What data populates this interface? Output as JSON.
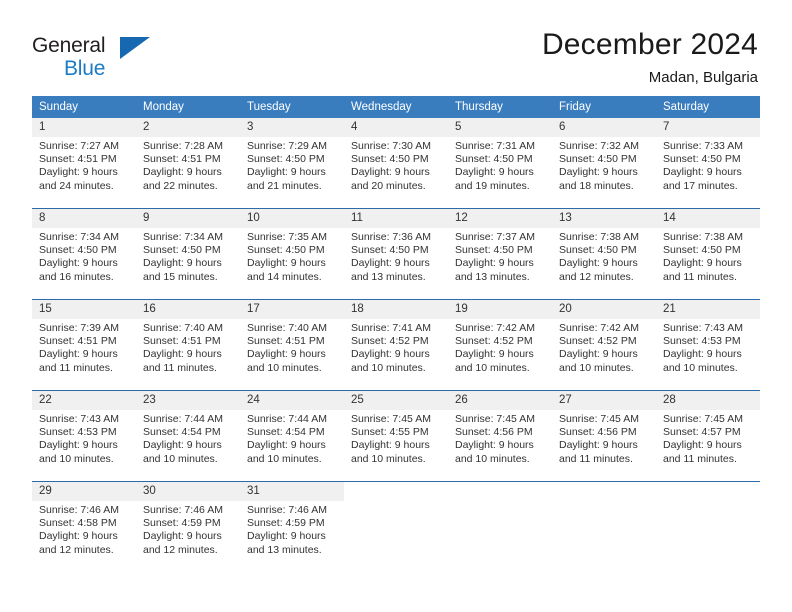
{
  "brand": {
    "name_top": "General",
    "name_bottom": "Blue",
    "accent_color": "#1668b0",
    "text_color": "#231f20"
  },
  "header": {
    "title": "December 2024",
    "subtitle": "Madan, Bulgaria"
  },
  "theme": {
    "header_bg": "#3a7dbf",
    "header_text": "#ffffff",
    "row_divider": "#2b6ca8",
    "daynum_bg": "#f0f0f0",
    "body_text": "#333333"
  },
  "weekday_headers": [
    "Sunday",
    "Monday",
    "Tuesday",
    "Wednesday",
    "Thursday",
    "Friday",
    "Saturday"
  ],
  "weeks": [
    [
      {
        "day": "1",
        "sunrise": "Sunrise: 7:27 AM",
        "sunset": "Sunset: 4:51 PM",
        "daylight_line1": "Daylight: 9 hours",
        "daylight_line2": "and 24 minutes."
      },
      {
        "day": "2",
        "sunrise": "Sunrise: 7:28 AM",
        "sunset": "Sunset: 4:51 PM",
        "daylight_line1": "Daylight: 9 hours",
        "daylight_line2": "and 22 minutes."
      },
      {
        "day": "3",
        "sunrise": "Sunrise: 7:29 AM",
        "sunset": "Sunset: 4:50 PM",
        "daylight_line1": "Daylight: 9 hours",
        "daylight_line2": "and 21 minutes."
      },
      {
        "day": "4",
        "sunrise": "Sunrise: 7:30 AM",
        "sunset": "Sunset: 4:50 PM",
        "daylight_line1": "Daylight: 9 hours",
        "daylight_line2": "and 20 minutes."
      },
      {
        "day": "5",
        "sunrise": "Sunrise: 7:31 AM",
        "sunset": "Sunset: 4:50 PM",
        "daylight_line1": "Daylight: 9 hours",
        "daylight_line2": "and 19 minutes."
      },
      {
        "day": "6",
        "sunrise": "Sunrise: 7:32 AM",
        "sunset": "Sunset: 4:50 PM",
        "daylight_line1": "Daylight: 9 hours",
        "daylight_line2": "and 18 minutes."
      },
      {
        "day": "7",
        "sunrise": "Sunrise: 7:33 AM",
        "sunset": "Sunset: 4:50 PM",
        "daylight_line1": "Daylight: 9 hours",
        "daylight_line2": "and 17 minutes."
      }
    ],
    [
      {
        "day": "8",
        "sunrise": "Sunrise: 7:34 AM",
        "sunset": "Sunset: 4:50 PM",
        "daylight_line1": "Daylight: 9 hours",
        "daylight_line2": "and 16 minutes."
      },
      {
        "day": "9",
        "sunrise": "Sunrise: 7:34 AM",
        "sunset": "Sunset: 4:50 PM",
        "daylight_line1": "Daylight: 9 hours",
        "daylight_line2": "and 15 minutes."
      },
      {
        "day": "10",
        "sunrise": "Sunrise: 7:35 AM",
        "sunset": "Sunset: 4:50 PM",
        "daylight_line1": "Daylight: 9 hours",
        "daylight_line2": "and 14 minutes."
      },
      {
        "day": "11",
        "sunrise": "Sunrise: 7:36 AM",
        "sunset": "Sunset: 4:50 PM",
        "daylight_line1": "Daylight: 9 hours",
        "daylight_line2": "and 13 minutes."
      },
      {
        "day": "12",
        "sunrise": "Sunrise: 7:37 AM",
        "sunset": "Sunset: 4:50 PM",
        "daylight_line1": "Daylight: 9 hours",
        "daylight_line2": "and 13 minutes."
      },
      {
        "day": "13",
        "sunrise": "Sunrise: 7:38 AM",
        "sunset": "Sunset: 4:50 PM",
        "daylight_line1": "Daylight: 9 hours",
        "daylight_line2": "and 12 minutes."
      },
      {
        "day": "14",
        "sunrise": "Sunrise: 7:38 AM",
        "sunset": "Sunset: 4:50 PM",
        "daylight_line1": "Daylight: 9 hours",
        "daylight_line2": "and 11 minutes."
      }
    ],
    [
      {
        "day": "15",
        "sunrise": "Sunrise: 7:39 AM",
        "sunset": "Sunset: 4:51 PM",
        "daylight_line1": "Daylight: 9 hours",
        "daylight_line2": "and 11 minutes."
      },
      {
        "day": "16",
        "sunrise": "Sunrise: 7:40 AM",
        "sunset": "Sunset: 4:51 PM",
        "daylight_line1": "Daylight: 9 hours",
        "daylight_line2": "and 11 minutes."
      },
      {
        "day": "17",
        "sunrise": "Sunrise: 7:40 AM",
        "sunset": "Sunset: 4:51 PM",
        "daylight_line1": "Daylight: 9 hours",
        "daylight_line2": "and 10 minutes."
      },
      {
        "day": "18",
        "sunrise": "Sunrise: 7:41 AM",
        "sunset": "Sunset: 4:52 PM",
        "daylight_line1": "Daylight: 9 hours",
        "daylight_line2": "and 10 minutes."
      },
      {
        "day": "19",
        "sunrise": "Sunrise: 7:42 AM",
        "sunset": "Sunset: 4:52 PM",
        "daylight_line1": "Daylight: 9 hours",
        "daylight_line2": "and 10 minutes."
      },
      {
        "day": "20",
        "sunrise": "Sunrise: 7:42 AM",
        "sunset": "Sunset: 4:52 PM",
        "daylight_line1": "Daylight: 9 hours",
        "daylight_line2": "and 10 minutes."
      },
      {
        "day": "21",
        "sunrise": "Sunrise: 7:43 AM",
        "sunset": "Sunset: 4:53 PM",
        "daylight_line1": "Daylight: 9 hours",
        "daylight_line2": "and 10 minutes."
      }
    ],
    [
      {
        "day": "22",
        "sunrise": "Sunrise: 7:43 AM",
        "sunset": "Sunset: 4:53 PM",
        "daylight_line1": "Daylight: 9 hours",
        "daylight_line2": "and 10 minutes."
      },
      {
        "day": "23",
        "sunrise": "Sunrise: 7:44 AM",
        "sunset": "Sunset: 4:54 PM",
        "daylight_line1": "Daylight: 9 hours",
        "daylight_line2": "and 10 minutes."
      },
      {
        "day": "24",
        "sunrise": "Sunrise: 7:44 AM",
        "sunset": "Sunset: 4:54 PM",
        "daylight_line1": "Daylight: 9 hours",
        "daylight_line2": "and 10 minutes."
      },
      {
        "day": "25",
        "sunrise": "Sunrise: 7:45 AM",
        "sunset": "Sunset: 4:55 PM",
        "daylight_line1": "Daylight: 9 hours",
        "daylight_line2": "and 10 minutes."
      },
      {
        "day": "26",
        "sunrise": "Sunrise: 7:45 AM",
        "sunset": "Sunset: 4:56 PM",
        "daylight_line1": "Daylight: 9 hours",
        "daylight_line2": "and 10 minutes."
      },
      {
        "day": "27",
        "sunrise": "Sunrise: 7:45 AM",
        "sunset": "Sunset: 4:56 PM",
        "daylight_line1": "Daylight: 9 hours",
        "daylight_line2": "and 11 minutes."
      },
      {
        "day": "28",
        "sunrise": "Sunrise: 7:45 AM",
        "sunset": "Sunset: 4:57 PM",
        "daylight_line1": "Daylight: 9 hours",
        "daylight_line2": "and 11 minutes."
      }
    ],
    [
      {
        "day": "29",
        "sunrise": "Sunrise: 7:46 AM",
        "sunset": "Sunset: 4:58 PM",
        "daylight_line1": "Daylight: 9 hours",
        "daylight_line2": "and 12 minutes."
      },
      {
        "day": "30",
        "sunrise": "Sunrise: 7:46 AM",
        "sunset": "Sunset: 4:59 PM",
        "daylight_line1": "Daylight: 9 hours",
        "daylight_line2": "and 12 minutes."
      },
      {
        "day": "31",
        "sunrise": "Sunrise: 7:46 AM",
        "sunset": "Sunset: 4:59 PM",
        "daylight_line1": "Daylight: 9 hours",
        "daylight_line2": "and 13 minutes."
      },
      {
        "day": "",
        "sunrise": "",
        "sunset": "",
        "daylight_line1": "",
        "daylight_line2": ""
      },
      {
        "day": "",
        "sunrise": "",
        "sunset": "",
        "daylight_line1": "",
        "daylight_line2": ""
      },
      {
        "day": "",
        "sunrise": "",
        "sunset": "",
        "daylight_line1": "",
        "daylight_line2": ""
      },
      {
        "day": "",
        "sunrise": "",
        "sunset": "",
        "daylight_line1": "",
        "daylight_line2": ""
      }
    ]
  ]
}
